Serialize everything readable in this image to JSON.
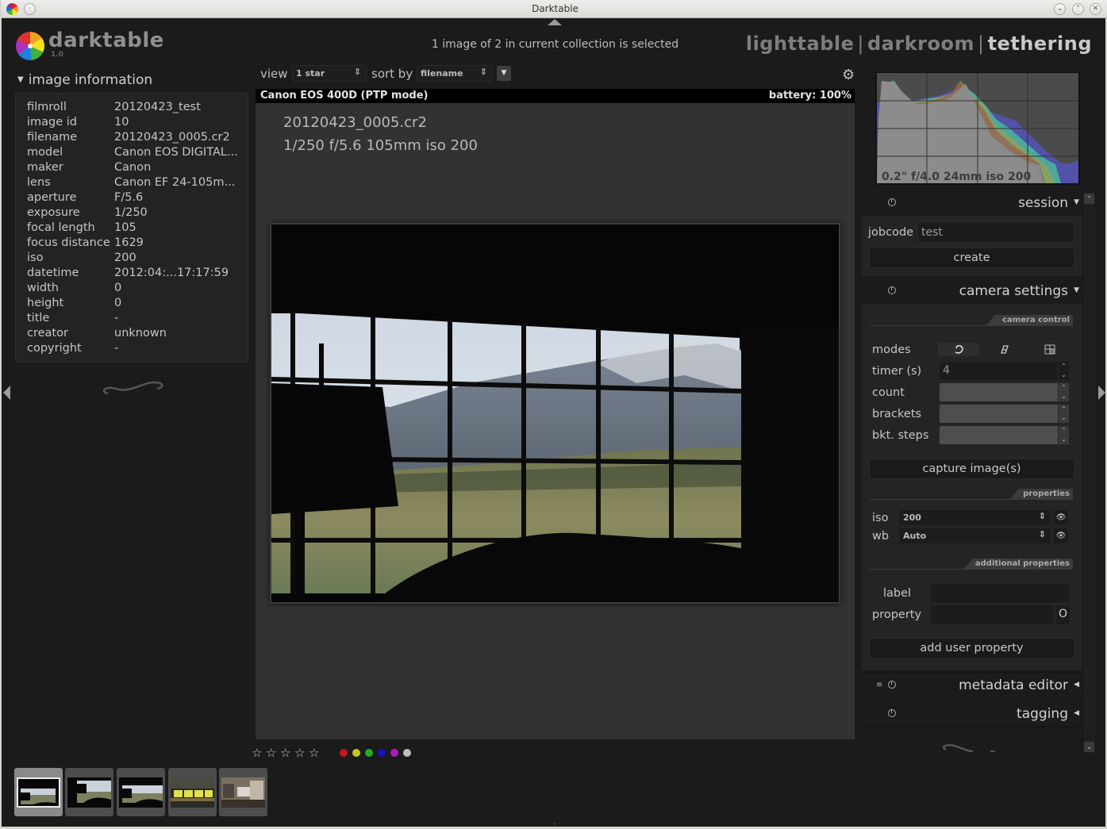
{
  "window": {
    "title": "Darktable",
    "controls": [
      "minimize",
      "maximize",
      "close"
    ]
  },
  "header": {
    "logo_text": "darktable",
    "version": "1.0",
    "selection_info": "1 image of 2 in current collection is selected",
    "views": [
      {
        "label": "lighttable",
        "active": false
      },
      {
        "label": "darkroom",
        "active": false
      },
      {
        "label": "tethering",
        "active": true
      }
    ],
    "view_separator": "|"
  },
  "left_panel": {
    "module_title": "image information",
    "rows": [
      {
        "key": "filmroll",
        "value": "20120423_test"
      },
      {
        "key": "image id",
        "value": "10"
      },
      {
        "key": "filename",
        "value": "20120423_0005.cr2"
      },
      {
        "key": "model",
        "value": "Canon EOS DIGITAL..."
      },
      {
        "key": "maker",
        "value": "Canon"
      },
      {
        "key": "lens",
        "value": "Canon EF 24-105m..."
      },
      {
        "key": "aperture",
        "value": "F/5.6"
      },
      {
        "key": "exposure",
        "value": "1/250"
      },
      {
        "key": "focal length",
        "value": "105"
      },
      {
        "key": "focus distance",
        "value": "1629"
      },
      {
        "key": "iso",
        "value": "200"
      },
      {
        "key": "datetime",
        "value": "2012:04:...17:17:59"
      },
      {
        "key": "width",
        "value": "0"
      },
      {
        "key": "height",
        "value": "0"
      },
      {
        "key": "title",
        "value": "-"
      },
      {
        "key": "creator",
        "value": "unknown"
      },
      {
        "key": "copyright",
        "value": "-"
      }
    ]
  },
  "toolbar": {
    "view_label": "view",
    "view_value": "1 star",
    "sort_label": "sort by",
    "sort_value": "filename",
    "sort_direction_icon": "▼",
    "settings_icon": "gear-icon"
  },
  "camera_bar": {
    "camera": "Canon EOS 400D (PTP mode)",
    "battery": "battery: 100%"
  },
  "center": {
    "image_filename": "20120423_0005.cr2",
    "image_exif": "1/250 f/5.6 105mm iso 200"
  },
  "rating": {
    "stars": 5,
    "stars_filled": 0,
    "color_labels": [
      {
        "name": "red",
        "color": "#c8161c"
      },
      {
        "name": "yellow",
        "color": "#c5c71a"
      },
      {
        "name": "green",
        "color": "#1fae22"
      },
      {
        "name": "blue",
        "color": "#1515b8"
      },
      {
        "name": "purple",
        "color": "#b01ab8"
      },
      {
        "name": "gray",
        "color": "#bdbdbd"
      }
    ]
  },
  "filmstrip": {
    "thumbnails": [
      {
        "name": "window-landscape-1",
        "selected": true
      },
      {
        "name": "window-landscape-2",
        "selected": false
      },
      {
        "name": "window-landscape-3",
        "selected": false
      },
      {
        "name": "yellow-notes",
        "selected": false
      },
      {
        "name": "room-clutter",
        "selected": false
      }
    ]
  },
  "histogram": {
    "info": "0.2\" f/4.0 24mm iso 200"
  },
  "right_panel": {
    "session": {
      "title": "session",
      "jobcode_label": "jobcode",
      "jobcode_value": "test",
      "create_button": "create"
    },
    "camera_settings": {
      "title": "camera settings",
      "camera_control_header": "camera control",
      "modes_label": "modes",
      "mode_icons": [
        "timer-mode-icon",
        "sequence-mode-icon",
        "bracket-mode-icon"
      ],
      "timer_label": "timer (s)",
      "timer_value": "4",
      "count_label": "count",
      "count_value": "",
      "brackets_label": "brackets",
      "brackets_value": "",
      "bkt_steps_label": "bkt. steps",
      "bkt_steps_value": "",
      "capture_button": "capture image(s)",
      "properties_header": "properties",
      "iso_label": "iso",
      "iso_value": "200",
      "wb_label": "wb",
      "wb_value": "Auto",
      "additional_header": "additional properties",
      "label_label": "label",
      "label_value": "",
      "property_label": "property",
      "property_value": "",
      "property_button": "O",
      "add_property_button": "add user property"
    },
    "metadata_editor": {
      "title": "metadata editor"
    },
    "tagging": {
      "title": "tagging"
    }
  }
}
